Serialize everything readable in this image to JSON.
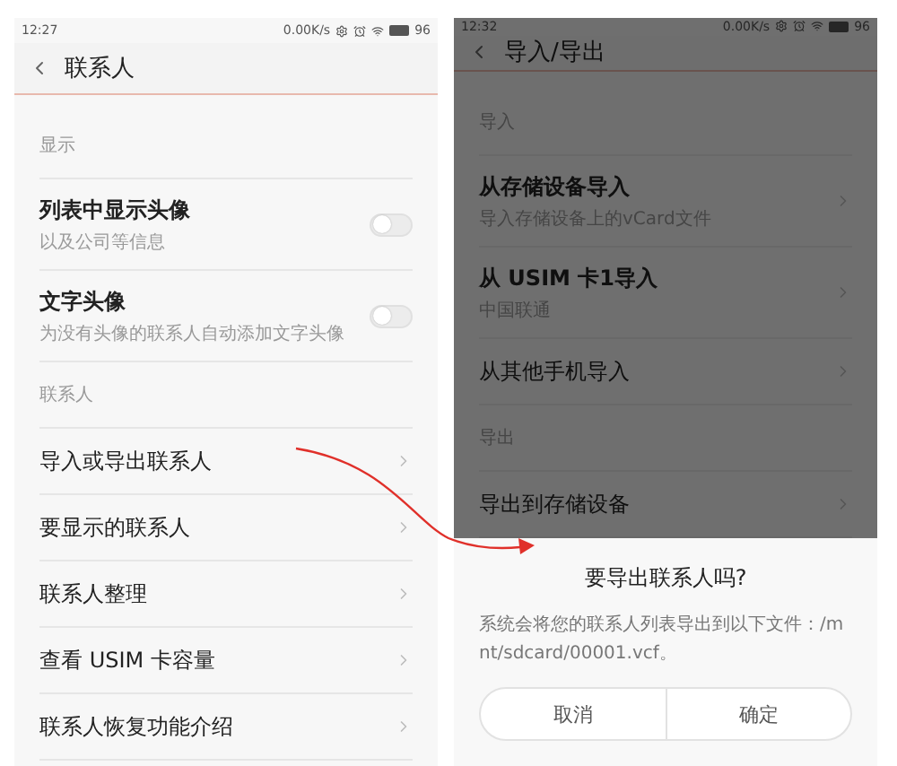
{
  "screens": [
    {
      "status_bar": {
        "time": "12:27",
        "speed": "0.00K/s",
        "battery": "96"
      },
      "title": "联系人",
      "dimmed": false,
      "sections": [
        {
          "header": "显示",
          "items": [
            {
              "kind": "toggle",
              "title": "列表中显示头像",
              "subtitle": "以及公司等信息",
              "on": false
            },
            {
              "kind": "toggle",
              "title": "文字头像",
              "subtitle": "为没有头像的联系人自动添加文字头像",
              "on": false
            }
          ]
        },
        {
          "header": "联系人",
          "items": [
            {
              "kind": "link",
              "title": "导入或导出联系人"
            },
            {
              "kind": "link",
              "title": "要显示的联系人"
            },
            {
              "kind": "link",
              "title": "联系人整理"
            },
            {
              "kind": "link",
              "title": "查看 USIM 卡容量"
            },
            {
              "kind": "link",
              "title": "联系人恢复功能介绍"
            }
          ]
        }
      ]
    },
    {
      "status_bar": {
        "time": "12:32",
        "speed": "0.00K/s",
        "battery": "96"
      },
      "title": "导入/导出",
      "dimmed": true,
      "sections": [
        {
          "header": "导入",
          "items": [
            {
              "kind": "link",
              "title": "从存储设备导入",
              "subtitle": "导入存储设备上的vCard文件"
            },
            {
              "kind": "link",
              "title": "从 USIM 卡1导入",
              "subtitle": "中国联通"
            },
            {
              "kind": "link",
              "title": "从其他手机导入"
            }
          ]
        },
        {
          "header": "导出",
          "items": [
            {
              "kind": "link",
              "title": "导出到存储设备"
            }
          ]
        }
      ],
      "dialog": {
        "title": "要导出联系人吗?",
        "message": "系统会将您的联系人列表导出到以下文件：/mnt/sdcard/00001.vcf。",
        "buttons": [
          "取消",
          "确定"
        ]
      }
    }
  ]
}
